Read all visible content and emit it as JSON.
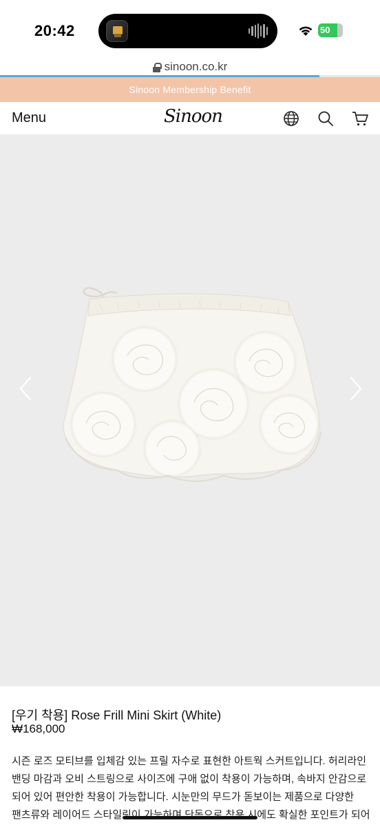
{
  "status_bar": {
    "time": "20:42",
    "battery_text": "50",
    "battery_level_percent": 50
  },
  "browser": {
    "url": "sinoon.co.kr",
    "load_progress_percent": 84
  },
  "banner": {
    "text": "Sinoon Membership Benefit",
    "color": "#f3c4a8"
  },
  "header": {
    "menu_label": "Menu",
    "logo_text": "Sinoon",
    "icons": [
      "globe-icon",
      "search-icon",
      "cart-icon"
    ]
  },
  "product": {
    "image_alt": "Rose Frill Mini Skirt white",
    "title": "[우기 착용] Rose Frill Mini Skirt (White)",
    "price": "₩168,000",
    "description": "시즌 로즈 모티브를 입체감 있는 프릴 자수로 표현한 아트웍 스커트입니다. 허리라인 밴딩 마감과 오비 스트링으로 사이즈에 구애 없이 착용이 가능하며, 속바지 안감으로 되어 있어 편안한 착용이 가능합니다. 시눈만의 무드가 돋보이는 제품으로 다양한 팬츠류와 레이어드 스타일링이 가능하며 단독으로 착용 시에도 확실한 포인트가 되어 소"
  },
  "colors": {
    "image_bg": "#ececec",
    "accent": "#f3c4a8"
  }
}
